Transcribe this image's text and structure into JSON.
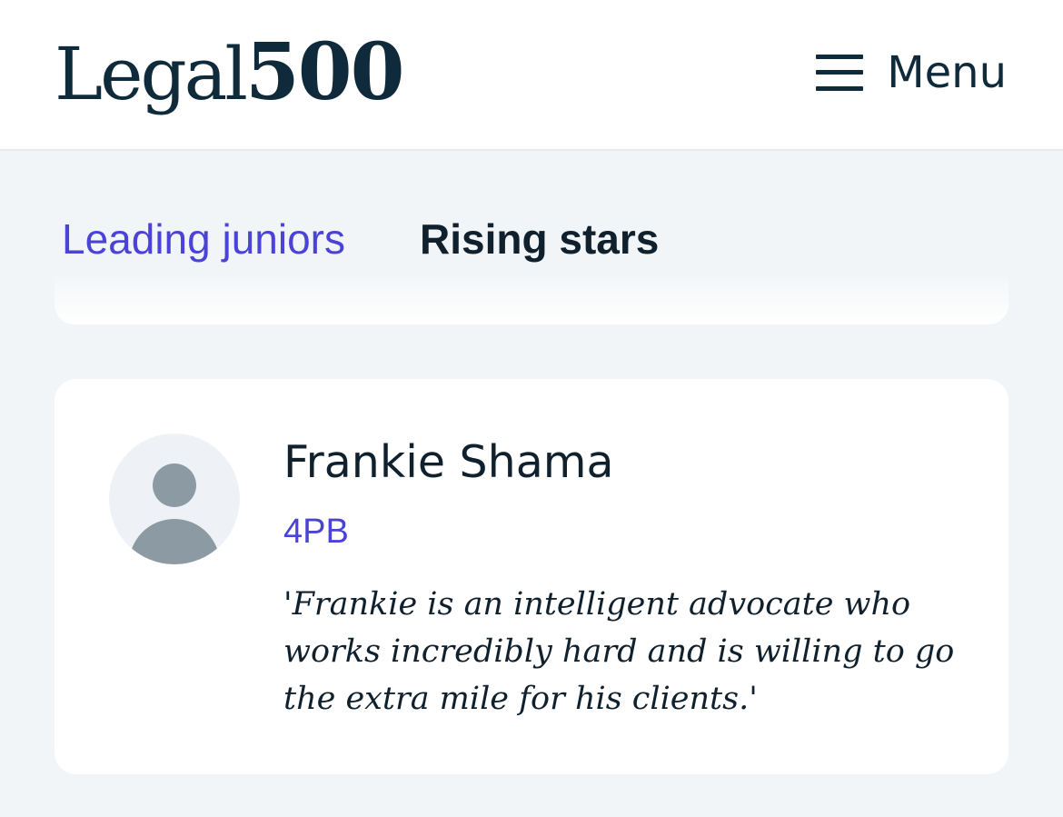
{
  "header": {
    "logo_word": "Legal",
    "logo_number": "500",
    "menu_label": "Menu",
    "menu_icon": "hamburger-icon"
  },
  "tabs": [
    {
      "label": "Leading juniors",
      "active": false
    },
    {
      "label": "Rising stars",
      "active": true
    }
  ],
  "profile": {
    "avatar_icon": "person-placeholder-icon",
    "name": "Frankie Shama",
    "firm": "4PB",
    "quote": "'Frankie is an intelligent advocate who works incredibly hard and is willing to go the extra mile for his clients.'"
  },
  "colors": {
    "brand_navy": "#0e2a3b",
    "link_purple": "#4b43d6",
    "page_background": "#f2f5f8",
    "avatar_grey": "#8c9aa3"
  }
}
